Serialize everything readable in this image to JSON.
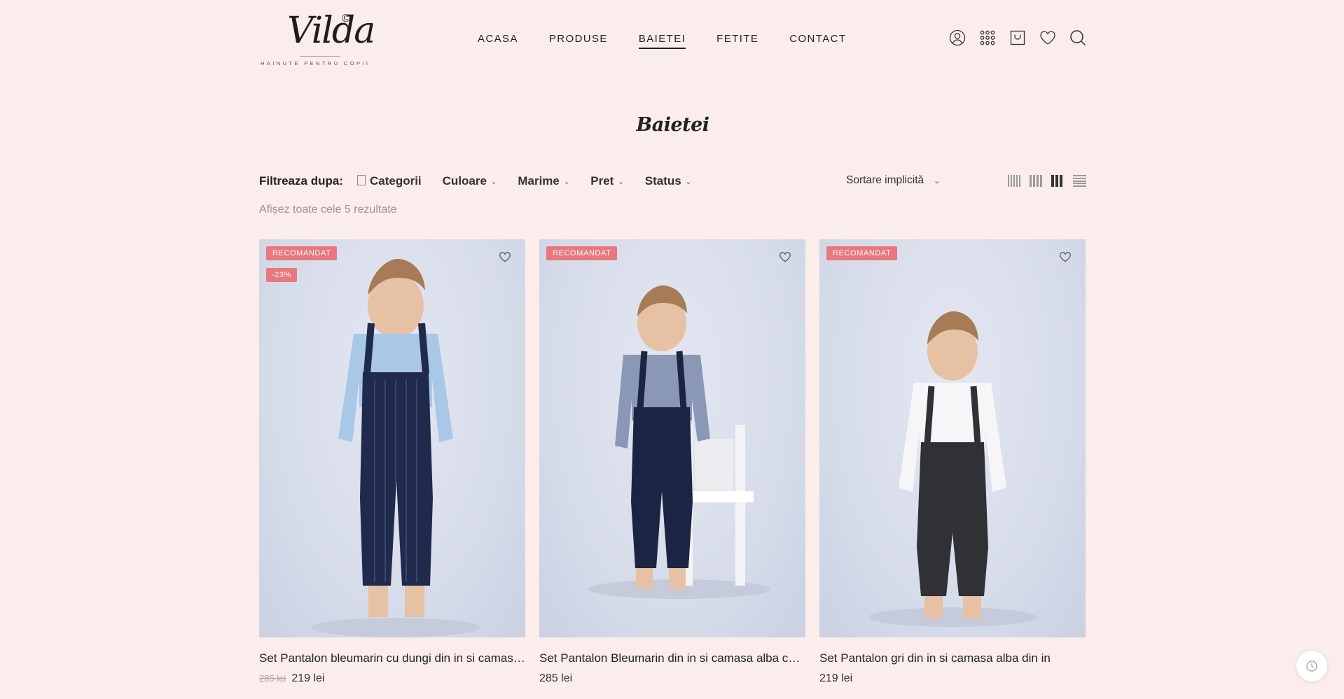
{
  "logo": {
    "name": "Vilda",
    "copyright": "©",
    "tagline": "HAINUTE PENTRU COPII"
  },
  "nav": {
    "items": [
      {
        "label": "ACASA"
      },
      {
        "label": "PRODUSE"
      },
      {
        "label": "BAIETEI",
        "active": true
      },
      {
        "label": "FETITE"
      },
      {
        "label": "CONTACT"
      }
    ]
  },
  "header_icons": [
    "user-icon",
    "grid-menu-icon",
    "cart-icon",
    "heart-icon",
    "search-icon"
  ],
  "page": {
    "title": "Baietei"
  },
  "filters": {
    "label": "Filtreaza dupa:",
    "items": [
      {
        "label": "Categorii"
      },
      {
        "label": "Culoare"
      },
      {
        "label": "Marime"
      },
      {
        "label": "Pret"
      },
      {
        "label": "Status"
      }
    ],
    "sort_label": "Sortare implicită"
  },
  "results_text": "Afișez toate cele 5 rezultate",
  "colors": {
    "background": "#fbedeb",
    "badge": "#e8787c"
  },
  "products": [
    {
      "badge": "RECOMANDAT",
      "discount": "-23%",
      "name": "Set Pantalon bleumarin cu dungi din in si camasa...",
      "old_price": "285 lei",
      "price": "219 lei"
    },
    {
      "badge": "RECOMANDAT",
      "name": "Set Pantalon Bleumarin din in si camasa alba cu ...",
      "price": "285 lei"
    },
    {
      "badge": "RECOMANDAT",
      "name": "Set Pantalon gri din in si camasa alba din in",
      "price": "219 lei"
    }
  ]
}
